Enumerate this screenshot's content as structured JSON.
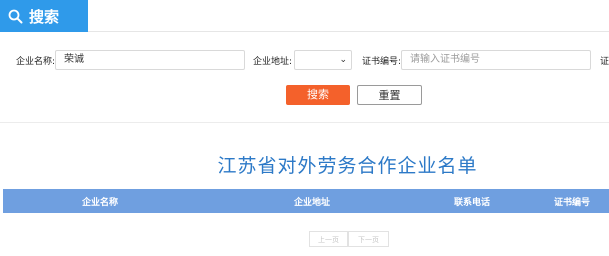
{
  "header": {
    "title": "搜索",
    "icon": "search-icon"
  },
  "form": {
    "company_name": {
      "label": "企业名称:",
      "value": "荣诚"
    },
    "company_address": {
      "label": "企业地址:",
      "value": ""
    },
    "cert_no": {
      "label": "证书编号:",
      "placeholder": "请输入证书编号"
    },
    "cert_no_extra_label": "证",
    "search_button": "搜索",
    "reset_button": "重置"
  },
  "list": {
    "title": "江苏省对外劳务合作企业名单",
    "columns": [
      "企业名称",
      "企业地址",
      "联系电话",
      "证书编号"
    ]
  },
  "pagination": {
    "prev": "上一页",
    "next": "下一页"
  },
  "colors": {
    "accent_blue": "#2f9aea",
    "search_button": "#f4612b",
    "table_header": "#6f9fe0",
    "title": "#2c79c7"
  }
}
